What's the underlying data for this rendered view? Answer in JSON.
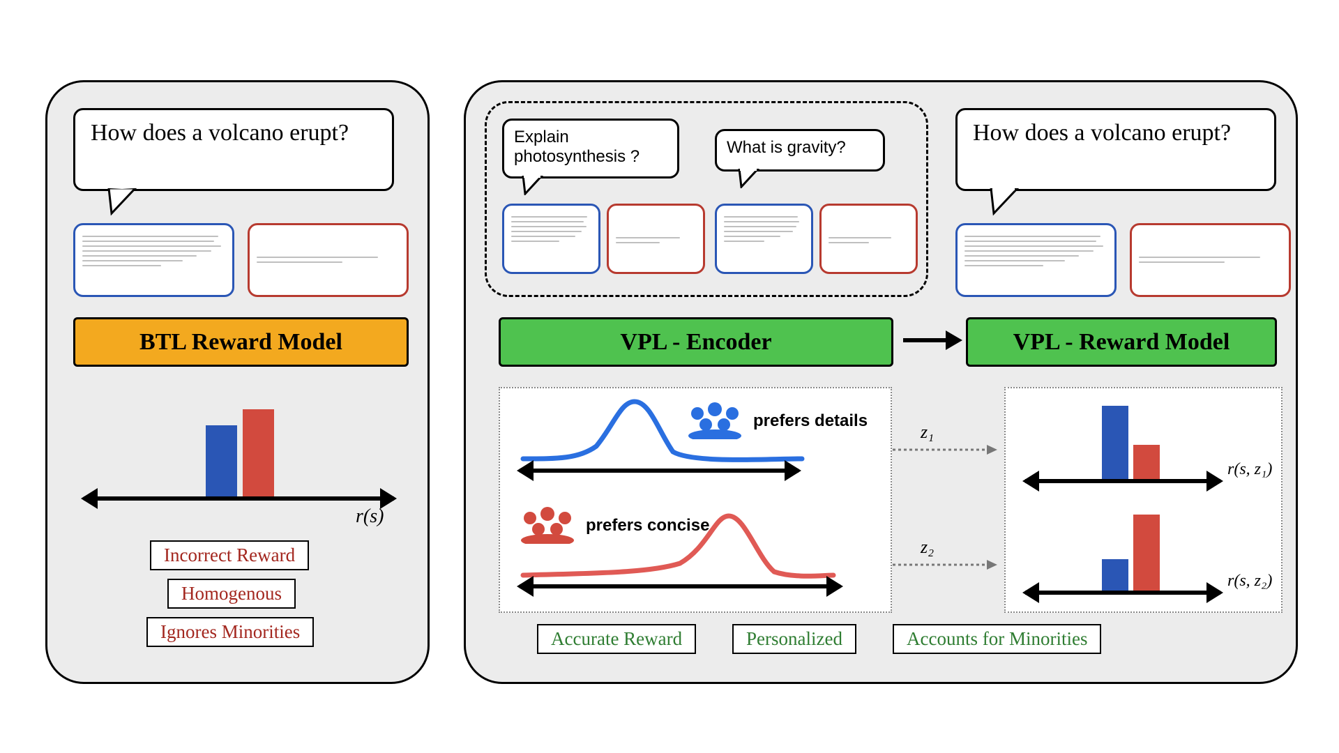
{
  "left": {
    "question": "How does a volcano erupt?",
    "model_label": "BTL Reward Model",
    "model_color": "#f3a91f",
    "axis_label": "r(s)",
    "tags": [
      "Incorrect Reward",
      "Homogenous",
      "Ignores Minorities"
    ]
  },
  "right": {
    "context_q1": "Explain photosynthesis ?",
    "context_q2": "What is gravity?",
    "question": "How does a volcano erupt?",
    "encoder_label": "VPL - Encoder",
    "reward_label": "VPL - Reward Model",
    "model_color": "#4fc24f",
    "pref_details": "prefers details",
    "pref_concise": "prefers concise",
    "z1": "z₁",
    "z2": "z₂",
    "r1": "r(s, z₁)",
    "r2": "r(s, z₂)",
    "tags": [
      "Accurate Reward",
      "Personalized",
      "Accounts for Minorities"
    ]
  },
  "colors": {
    "blue": "#2a56b5",
    "red": "#d24a3e"
  },
  "chart_data": {
    "type": "bar",
    "title": "",
    "left_bars": {
      "blue": 0.78,
      "red": 0.95,
      "note": "relative heights"
    },
    "right_z1": {
      "blue": 0.95,
      "red": 0.45
    },
    "right_z2": {
      "blue": 0.4,
      "red": 0.95
    },
    "latent_curves": {
      "details_peak": "left",
      "concise_peak": "right"
    }
  }
}
